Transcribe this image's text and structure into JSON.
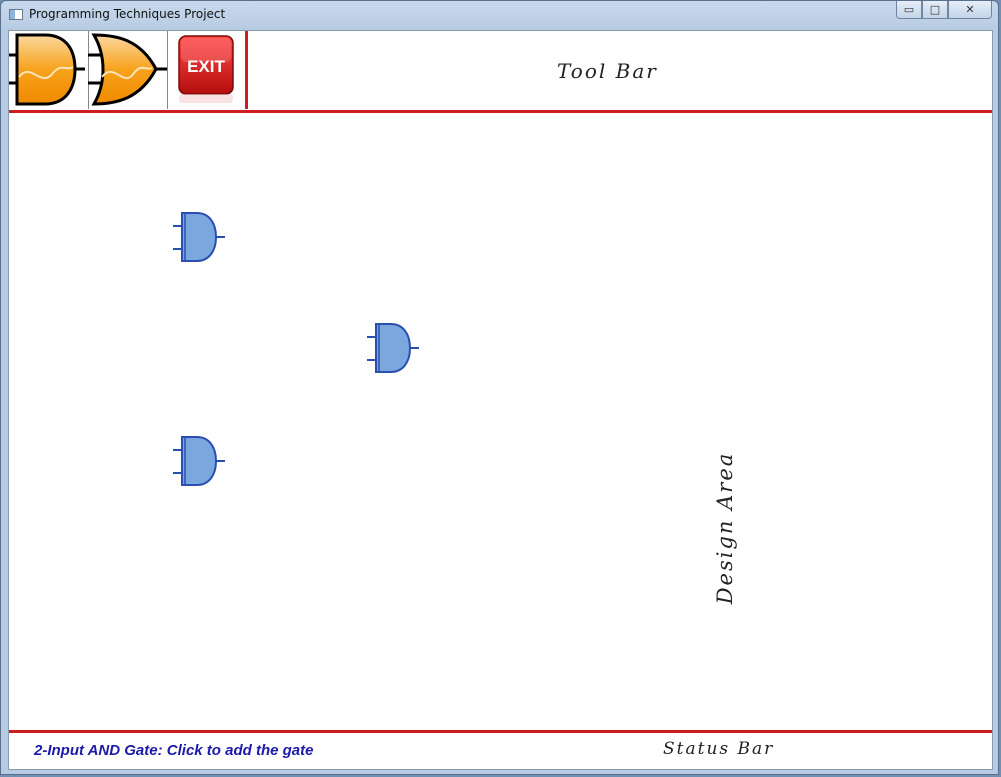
{
  "window": {
    "title": "Programming Techniques Project",
    "controls": {
      "minimize_glyph": "▭",
      "maximize_glyph": "□",
      "close_glyph": "✕"
    }
  },
  "toolbar": {
    "label": "Tool Bar",
    "tools": [
      {
        "name": "and-gate-tool",
        "icon": "and-gate-icon"
      },
      {
        "name": "or-gate-tool",
        "icon": "or-gate-icon"
      },
      {
        "name": "exit-tool",
        "icon": "exit-icon",
        "text": "EXIT"
      }
    ]
  },
  "design_area": {
    "label": "Design Area",
    "gates": [
      {
        "type": "AND"
      },
      {
        "type": "AND"
      },
      {
        "type": "AND"
      }
    ]
  },
  "status_bar": {
    "message": "2-Input AND Gate: Click to add the gate",
    "label": "Status Bar"
  },
  "colors": {
    "accent_red": "#cc1e1e",
    "gate_fill": "#7aa7dd",
    "gate_stroke": "#2b4fb0",
    "tool_fill": "#f7a21b",
    "status_text": "#1b1ba8"
  }
}
